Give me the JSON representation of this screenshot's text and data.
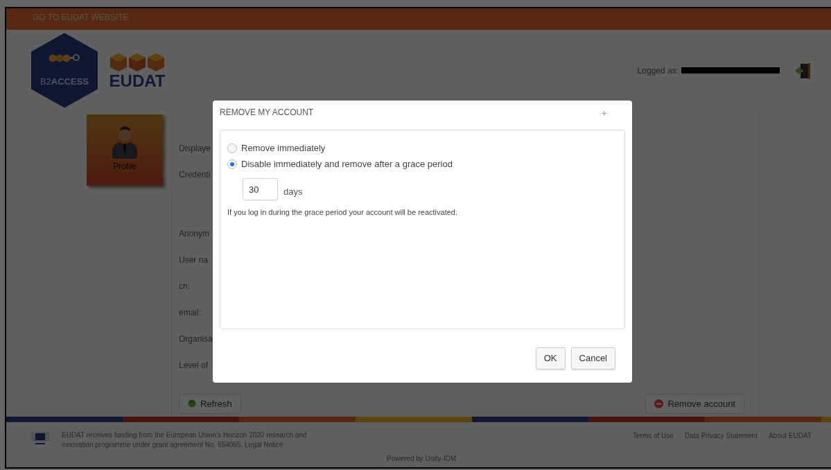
{
  "top_bar": {
    "link": "GO TO EUDAT WEBSITE"
  },
  "header": {
    "badge_text": "B2**ACCESS**",
    "brand_text": "EUDAT",
    "user_label": "Logged as:"
  },
  "sidebar": {
    "tiles": [
      {
        "label": "Profile"
      }
    ]
  },
  "profile": {
    "fields": [
      {
        "kind": "attribute",
        "label": "Displaye"
      },
      {
        "kind": "credential",
        "label": "Credenti"
      },
      {
        "kind": "attribute",
        "label": "Anonym"
      },
      {
        "kind": "attribute",
        "label": "User na"
      },
      {
        "kind": "attribute",
        "label": "cn:"
      },
      {
        "kind": "attribute",
        "label": "email:"
      },
      {
        "kind": "attribute",
        "label": "Organisa"
      },
      {
        "kind": "attribute",
        "label": "Level of"
      }
    ],
    "refresh_button": "Refresh",
    "remove_button": "Remove account"
  },
  "footer": {
    "funding": "EUDAT receives funding from the European Union’s Horizon 2020 research and innovation programme under grant agreement No. 654065. Legal Notice",
    "links": [
      "Terms of Use",
      "Data Privacy Statement",
      "About EUDAT"
    ],
    "powered": "Powered by Unity-IDM"
  },
  "dialog": {
    "title": "REMOVE MY ACCOUNT",
    "close": "+",
    "options": [
      {
        "label": "Remove immediately",
        "selected": false
      },
      {
        "label": "Disable immediately and remove after a grace period",
        "selected": true
      }
    ],
    "grace": {
      "value": "30",
      "unit": "days"
    },
    "hint": "If you log in during the grace period your account will be reactivated.",
    "buttons": [
      "OK",
      "Cancel"
    ]
  }
}
